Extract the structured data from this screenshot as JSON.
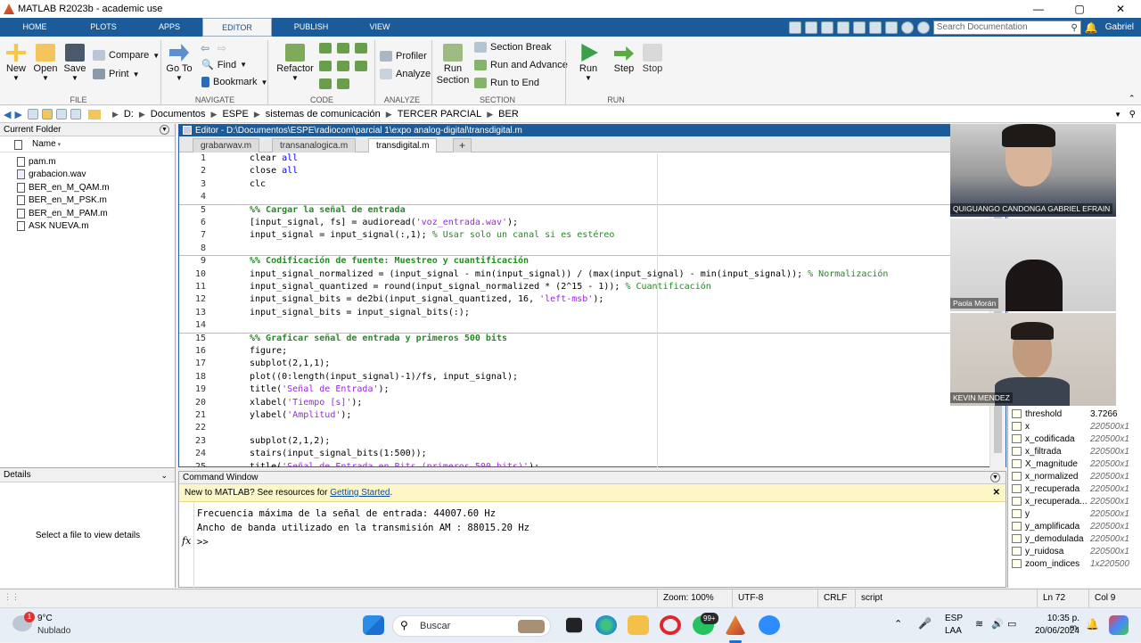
{
  "window": {
    "title": "MATLAB R2023b - academic use",
    "min": "—",
    "max": "▢",
    "close": "✕"
  },
  "ribbon_tabs": [
    "HOME",
    "PLOTS",
    "APPS",
    "EDITOR",
    "PUBLISH",
    "VIEW"
  ],
  "search": {
    "placeholder": "Search Documentation"
  },
  "user": "Gabriel",
  "ribbon": {
    "file": {
      "new": "New",
      "open": "Open",
      "save": "Save",
      "compare": "Compare",
      "print": "Print",
      "group": "FILE"
    },
    "navigate": {
      "goto": "Go To",
      "find": "Find",
      "bookmark": "Bookmark",
      "group": "NAVIGATE"
    },
    "code": {
      "refactor": "Refactor",
      "group": "CODE"
    },
    "analyze": {
      "profiler": "Profiler",
      "analyze": "Analyze",
      "group": "ANALYZE"
    },
    "section": {
      "run_section": "Run Section",
      "section_break": "Section Break",
      "run_advance": "Run and Advance",
      "run_end": "Run to End",
      "group": "SECTION"
    },
    "run": {
      "run": "Run",
      "step": "Step",
      "stop": "Stop",
      "group": "RUN"
    }
  },
  "address": [
    "D:",
    "Documentos",
    "ESPE",
    "sistemas de comunicación",
    "TERCER PARCIAL",
    "BER"
  ],
  "current_folder": {
    "title": "Current Folder",
    "column": "Name",
    "files": [
      {
        "name": "pam.m",
        "type": "m"
      },
      {
        "name": "grabacion.wav",
        "type": "wav"
      },
      {
        "name": "BER_en_M_QAM.m",
        "type": "m"
      },
      {
        "name": "BER_en_M_PSK.m",
        "type": "m"
      },
      {
        "name": "BER_en_M_PAM.m",
        "type": "m"
      },
      {
        "name": "ASK NUEVA.m",
        "type": "m"
      }
    ]
  },
  "details": {
    "title": "Details",
    "message": "Select a file to view details"
  },
  "editor": {
    "title": "Editor - D:\\Documentos\\ESPE\\radiocom\\parcial 1\\expo analog-digital\\transdigital.m",
    "tabs": [
      "grabarwav.m",
      "transanalogica.m",
      "transdigital.m"
    ],
    "add_tab": "+",
    "lines": [
      {
        "n": "1",
        "parts": [
          [
            "",
            "clear "
          ],
          [
            "kw",
            "all"
          ]
        ]
      },
      {
        "n": "2",
        "parts": [
          [
            "",
            "close "
          ],
          [
            "kw",
            "all"
          ]
        ]
      },
      {
        "n": "3",
        "parts": [
          [
            "",
            "clc"
          ]
        ]
      },
      {
        "n": "4",
        "parts": []
      },
      {
        "n": "5",
        "parts": [
          [
            "sec",
            "%% Cargar la señal de entrada"
          ]
        ],
        "section": true
      },
      {
        "n": "6",
        "parts": [
          [
            "",
            "[input_signal, fs] = audioread("
          ],
          [
            "str",
            "'voz_entrada.wav'"
          ],
          [
            "",
            ");"
          ]
        ]
      },
      {
        "n": "7",
        "parts": [
          [
            "",
            "input_signal = input_signal(:,1); "
          ],
          [
            "cm",
            "% Usar solo un canal si es estéreo"
          ]
        ]
      },
      {
        "n": "8",
        "parts": []
      },
      {
        "n": "9",
        "parts": [
          [
            "sec",
            "%% Codificación de fuente: Muestreo y cuantificación"
          ]
        ],
        "section": true
      },
      {
        "n": "10",
        "parts": [
          [
            "",
            "input_signal_normalized = (input_signal - min(input_signal)) / (max(input_signal) - min(input_signal)); "
          ],
          [
            "cm",
            "% Normalización"
          ]
        ]
      },
      {
        "n": "11",
        "parts": [
          [
            "",
            "input_signal_quantized = round(input_signal_normalized * (2^15 - 1)); "
          ],
          [
            "cm",
            "% Cuantificación"
          ]
        ]
      },
      {
        "n": "12",
        "parts": [
          [
            "",
            "input_signal_bits = de2bi(input_signal_quantized, 16, "
          ],
          [
            "str",
            "'left-msb'"
          ],
          [
            "",
            ");"
          ]
        ]
      },
      {
        "n": "13",
        "parts": [
          [
            "",
            "input_signal_bits = input_signal_bits(:);"
          ]
        ]
      },
      {
        "n": "14",
        "parts": []
      },
      {
        "n": "15",
        "parts": [
          [
            "sec",
            "%% Graficar señal de entrada y primeros 500 bits"
          ]
        ],
        "section": true
      },
      {
        "n": "16",
        "parts": [
          [
            "",
            "figure;"
          ]
        ]
      },
      {
        "n": "17",
        "parts": [
          [
            "",
            "subplot(2,1,1);"
          ]
        ]
      },
      {
        "n": "18",
        "parts": [
          [
            "",
            "plot((0:length(input_signal)-1)/fs, input_signal);"
          ]
        ]
      },
      {
        "n": "19",
        "parts": [
          [
            "",
            "title("
          ],
          [
            "str",
            "'Señal de Entrada'"
          ],
          [
            "",
            ");"
          ]
        ]
      },
      {
        "n": "20",
        "parts": [
          [
            "",
            "xlabel("
          ],
          [
            "str",
            "'Tiempo [s]'"
          ],
          [
            "",
            ");"
          ]
        ]
      },
      {
        "n": "21",
        "parts": [
          [
            "",
            "ylabel("
          ],
          [
            "str",
            "'Amplitud'"
          ],
          [
            "",
            ");"
          ]
        ]
      },
      {
        "n": "22",
        "parts": []
      },
      {
        "n": "23",
        "parts": [
          [
            "",
            "subplot(2,1,2);"
          ]
        ]
      },
      {
        "n": "24",
        "parts": [
          [
            "",
            "stairs(input_signal_bits(1:500));"
          ]
        ]
      },
      {
        "n": "25",
        "parts": [
          [
            "",
            "title("
          ],
          [
            "str",
            "'Señal de Entrada en Bits (primeros 500 bits)'"
          ],
          [
            "",
            ");"
          ]
        ]
      }
    ]
  },
  "command_window": {
    "title": "Command Window",
    "notice_prefix": "New to MATLAB? See resources for ",
    "notice_link": "Getting Started",
    "notice_suffix": ".",
    "output": [
      "Frecuencia máxima de la señal de entrada: 44007.60 Hz",
      "Ancho de banda utilizado en la transmisión AM : 88015.20 Hz"
    ],
    "prompt": ">>",
    "fx": "fx"
  },
  "workspace": {
    "variables": [
      {
        "name": "threshold",
        "value": "3.7266",
        "numeric": true
      },
      {
        "name": "x",
        "value": "220500x1"
      },
      {
        "name": "x_codificada",
        "value": "220500x1"
      },
      {
        "name": "x_filtrada",
        "value": "220500x1"
      },
      {
        "name": "X_magnitude",
        "value": "220500x1"
      },
      {
        "name": "x_normalized",
        "value": "220500x1"
      },
      {
        "name": "x_recuperada",
        "value": "220500x1"
      },
      {
        "name": "x_recuperada...",
        "value": "220500x1"
      },
      {
        "name": "y",
        "value": "220500x1"
      },
      {
        "name": "y_amplificada",
        "value": "220500x1"
      },
      {
        "name": "y_demodulada",
        "value": "220500x1"
      },
      {
        "name": "y_ruidosa",
        "value": "220500x1"
      },
      {
        "name": "zoom_indices",
        "value": "1x220500"
      }
    ]
  },
  "video": [
    {
      "name": "QUIGUANGO CANDONGA GABRIEL EFRAIN"
    },
    {
      "name": "Paola Morán"
    },
    {
      "name": "KEVIN MENDEZ"
    }
  ],
  "status": {
    "zoom": "Zoom: 100%",
    "encoding": "UTF-8",
    "eol": "CRLF",
    "type": "script",
    "ln": "Ln  72",
    "col": "Col  9"
  },
  "taskbar": {
    "weather_temp": "9°C",
    "weather_desc": "Nublado",
    "weather_badge": "1",
    "search": "Buscar",
    "whatsapp_badge": "99+",
    "lang": "ESP",
    "lang2": "LAA",
    "time": "10:35 p. m.",
    "date": "20/06/2024"
  },
  "colors": {
    "accent": "#1b5b9a",
    "keyword": "#0000ff",
    "string": "#a020f0",
    "comment": "#228b22"
  }
}
